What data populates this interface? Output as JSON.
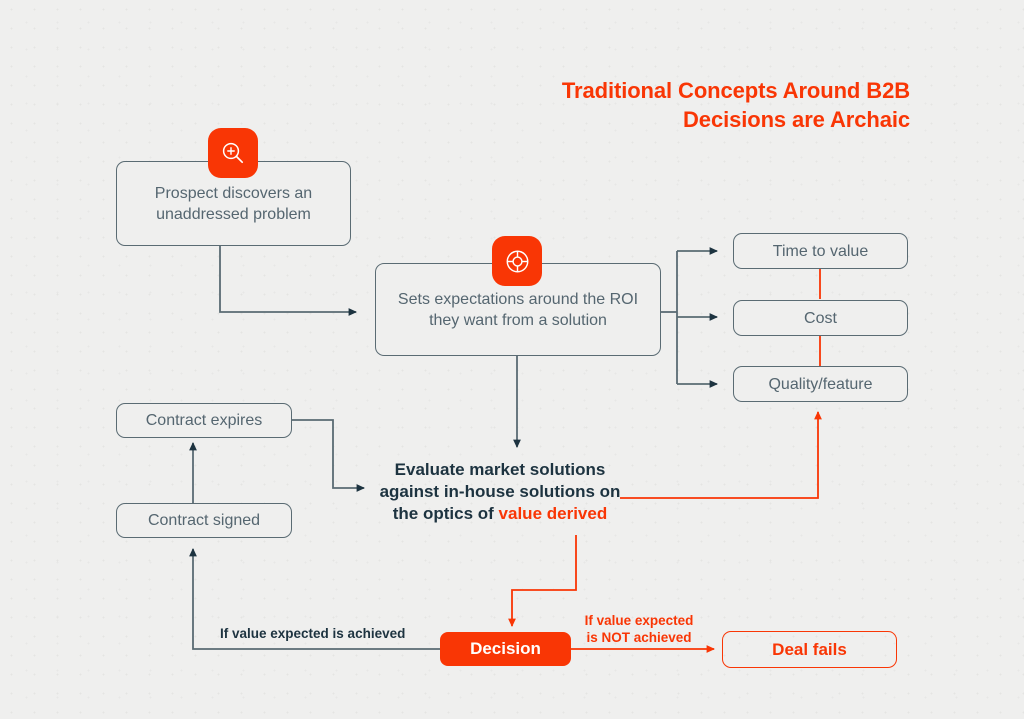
{
  "title": {
    "line1": "Traditional Concepts Around B2B",
    "line2": "Decisions are Archaic"
  },
  "colors": {
    "accent": "#f93605",
    "node_border": "#5a6b73",
    "node_text": "#556670",
    "dark_text": "#1d3340",
    "background": "#efefee"
  },
  "icons": {
    "zoom_in": "zoom-in-icon",
    "lifebuoy": "lifebuoy-icon"
  },
  "nodes": {
    "prospect": "Prospect discovers an unaddressed problem",
    "expectations": "Sets expectations around the ROI they want from a solution",
    "time_to_value": "Time to value",
    "cost": "Cost",
    "quality_feature": "Quality/feature",
    "contract_expires": "Contract expires",
    "contract_signed": "Contract signed",
    "decision": "Decision",
    "deal_fails": "Deal fails"
  },
  "evaluate": {
    "line1": "Evaluate market solutions",
    "line2": "against in-house solutions on",
    "line3_prefix": "the optics of ",
    "line3_highlight": "value derived"
  },
  "edge_labels": {
    "achieved": "If value expected is achieved",
    "not_achieved_line1": "If value expected",
    "not_achieved_line2": "is NOT achieved"
  }
}
